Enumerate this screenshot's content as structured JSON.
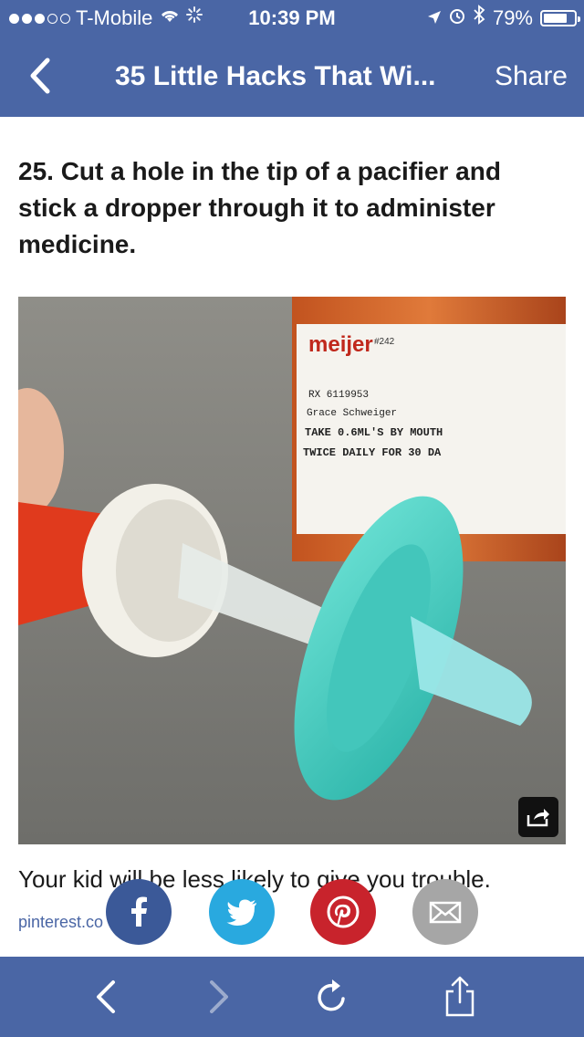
{
  "status_bar": {
    "carrier": "T-Mobile",
    "time": "10:39 PM",
    "battery": "79%",
    "battery_level": 0.79,
    "signal_bars": 3
  },
  "nav": {
    "title": "35 Little Hacks That Wi...",
    "share_label": "Share",
    "back_icon": "chevron-left-icon"
  },
  "article": {
    "headline": "25. Cut a hole in the tip of a pacifier and stick a dropper through it to administer medicine.",
    "caption": "Your kid will be less likely to give you trouble.",
    "source": "pinterest.co"
  },
  "photo": {
    "label_brand": "meijer",
    "label_store": "#242",
    "label_lines": [
      "RX 6119953",
      "Grace Schweiger",
      "TAKE 0.6ML'S BY MOUTH",
      "TWICE DAILY FOR 30 DA"
    ]
  },
  "social": [
    {
      "name": "facebook",
      "icon": "facebook-icon",
      "color": "#3b5998"
    },
    {
      "name": "twitter",
      "icon": "twitter-icon",
      "color": "#29a9df"
    },
    {
      "name": "pinterest",
      "icon": "pinterest-icon",
      "color": "#c8232c"
    },
    {
      "name": "email",
      "icon": "mail-icon",
      "color": "#a6a6a6"
    }
  ],
  "toolbar": {
    "back_icon": "chevron-left-icon",
    "forward_icon": "chevron-right-icon",
    "reload_icon": "reload-icon",
    "share_icon": "share-icon"
  },
  "colors": {
    "bar_blue": "#4a66a5",
    "text": "#1a1a1a",
    "link": "#4a66a5"
  }
}
